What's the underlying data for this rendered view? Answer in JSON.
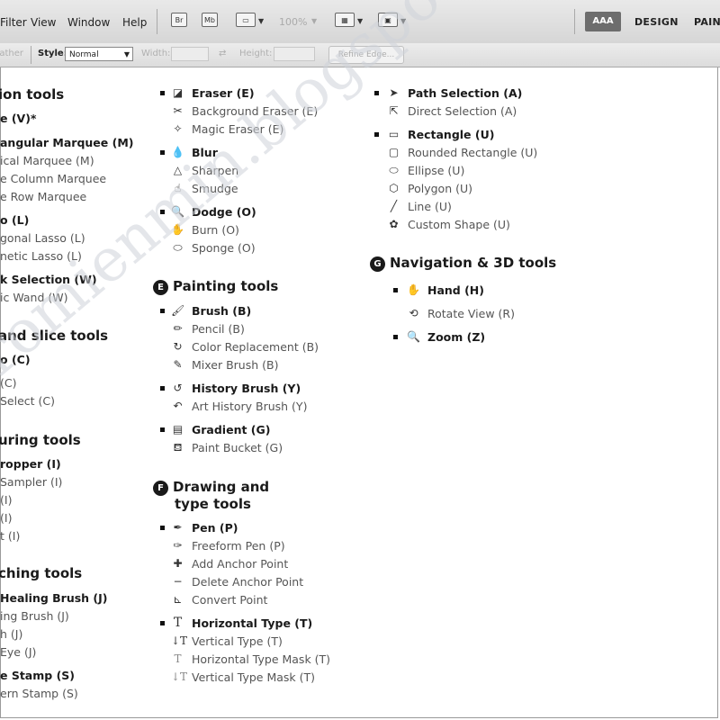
{
  "menubar": {
    "items": [
      "Filter",
      "View",
      "Window",
      "Help"
    ],
    "zoom": "100%",
    "workspace_active": "AAA",
    "workspace_tabs": [
      "DESIGN",
      "PAINT"
    ]
  },
  "options": {
    "feather_label": "Feather",
    "style_label": "Style:",
    "style_value": "Normal",
    "width_label": "Width:",
    "height_label": "Height:",
    "refine_label": "Refine Edge..."
  },
  "col1": {
    "h_selection": "ion tools",
    "items": [
      "e  (V)*",
      "angular Marquee  (M)",
      "ical Marquee  (M)",
      "e Column Marquee",
      "e Row Marquee",
      "o  (L)",
      "gonal Lasso  (L)",
      "netic Lasso  (L)",
      "k Selection  (W)",
      "ic Wand  (W)"
    ],
    "h_crop": "and slice tools",
    "crop_items": [
      "o  (C)",
      "(C)",
      "Select  (C)"
    ],
    "h_measuring": "uring tools",
    "measuring_items": [
      "ropper  (I)",
      "Sampler  (I)",
      "(I)",
      "(I)",
      "t  (I)"
    ],
    "h_retouching": "ching tools",
    "retouching_items": [
      "Healing Brush  (J)",
      "ing Brush  (J)",
      "h  (J)",
      "Eye  (J)",
      "e Stamp  (S)",
      "ern Stamp  (S)"
    ]
  },
  "col2": {
    "items1": [
      "Eraser  (E)",
      "Background Eraser  (E)",
      "Magic Eraser  (E)",
      "Blur",
      "Sharpen",
      "Smudge",
      "Dodge  (O)",
      "Burn  (O)",
      "Sponge  (O)"
    ],
    "badge_e": "E",
    "h_painting": "Painting tools",
    "painting_items": [
      "Brush  (B)",
      "Pencil  (B)",
      "Color Replacement  (B)",
      "Mixer Brush  (B)",
      "History Brush  (Y)",
      "Art History Brush  (Y)",
      "Gradient  (G)",
      "Paint Bucket  (G)"
    ],
    "badge_f": "F",
    "h_drawing_1": "Drawing and",
    "h_drawing_2": "type tools",
    "drawing_items": [
      "Pen  (P)",
      "Freeform Pen  (P)",
      "Add Anchor Point",
      "Delete Anchor Point",
      "Convert Point",
      "Horizontal Type  (T)",
      "Vertical Type  (T)",
      "Horizontal Type Mask  (T)",
      "Vertical Type Mask  (T)"
    ]
  },
  "col3": {
    "items": [
      "Path Selection  (A)",
      "Direct Selection  (A)",
      "Rectangle  (U)",
      "Rounded Rectangle  (U)",
      "Ellipse  (U)",
      "Polygon  (U)",
      "Line  (U)",
      "Custom Shape  (U)"
    ],
    "badge_g": "G",
    "h_nav": "Navigation & 3D tools",
    "nav_items": [
      "Hand  (H)",
      "Rotate View  (R)",
      "Zoom  (Z)"
    ]
  },
  "watermark": "tromienmin.blogspot.com"
}
